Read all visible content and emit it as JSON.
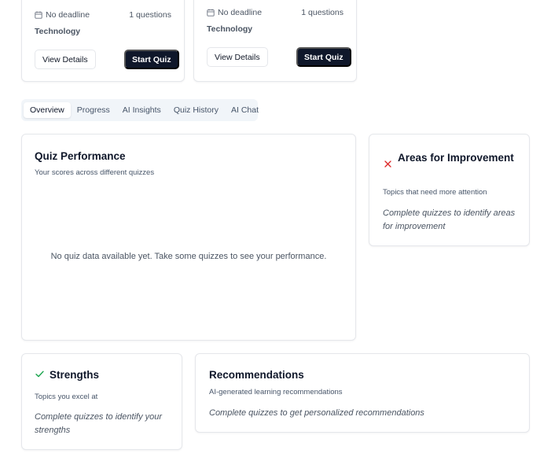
{
  "quiz_cards": [
    {
      "deadline": "No deadline",
      "questions": "1 questions",
      "category": "Technology",
      "view_label": "View Details",
      "start_label": "Start Quiz"
    },
    {
      "deadline": "No deadline",
      "questions": "1 questions",
      "category": "Technology",
      "view_label": "View Details",
      "start_label": "Start Quiz"
    }
  ],
  "tabs": [
    {
      "label": "Overview",
      "active": true
    },
    {
      "label": "Progress"
    },
    {
      "label": "AI Insights"
    },
    {
      "label": "Quiz History"
    },
    {
      "label": "AI Chat"
    }
  ],
  "performance": {
    "title": "Quiz Performance",
    "subtitle": "Your scores across different quizzes",
    "empty": "No quiz data available yet. Take some quizzes to see your performance."
  },
  "improvement": {
    "title": "Areas for Improvement",
    "subtitle": "Topics that need more attention",
    "body": "Complete quizzes to identify areas for improvement",
    "icon": "x-icon",
    "icon_color": "#dc2626"
  },
  "strengths": {
    "title": "Strengths",
    "subtitle": "Topics you excel at",
    "body": "Complete quizzes to identify your strengths",
    "icon": "check-icon",
    "icon_color": "#16a34a"
  },
  "recommendations": {
    "title": "Recommendations",
    "subtitle": "AI-generated learning recommendations",
    "body": "Complete quizzes to get personalized recommendations"
  }
}
